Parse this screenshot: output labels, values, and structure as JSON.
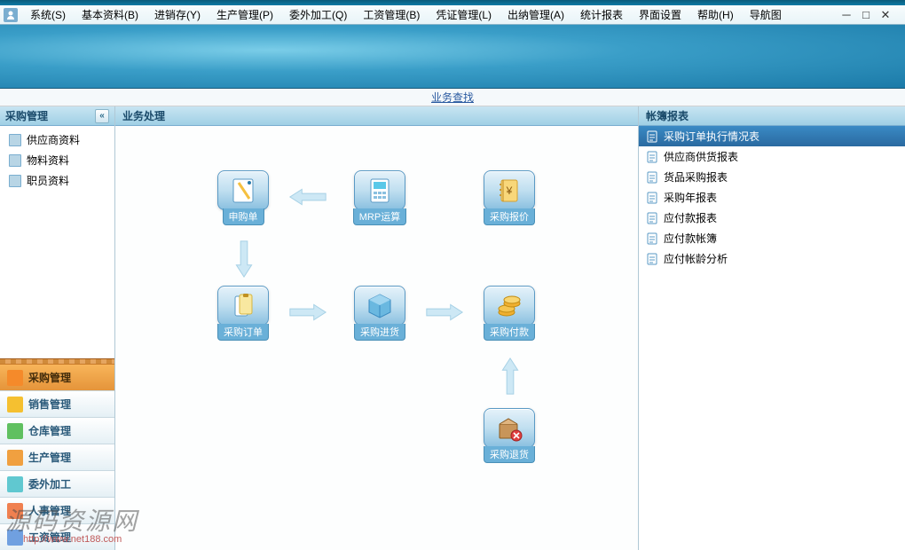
{
  "menu": {
    "items": [
      {
        "label": "系统",
        "k": "S"
      },
      {
        "label": "基本资料",
        "k": "B"
      },
      {
        "label": "进销存",
        "k": "Y"
      },
      {
        "label": "生产管理",
        "k": "P"
      },
      {
        "label": "委外加工",
        "k": "Q"
      },
      {
        "label": "工资管理",
        "k": "B"
      },
      {
        "label": "凭证管理",
        "k": "L"
      },
      {
        "label": "出纳管理",
        "k": "A"
      },
      {
        "label": "统计报表",
        "k": ""
      },
      {
        "label": "界面设置",
        "k": ""
      },
      {
        "label": "帮助",
        "k": "H"
      },
      {
        "label": "导航图",
        "k": ""
      }
    ]
  },
  "toplink": "业务查找",
  "sidebar": {
    "title": "采购管理",
    "items": [
      "供应商资料",
      "物料资料",
      "职员资料"
    ],
    "stack": [
      {
        "label": "采购管理",
        "active": true
      },
      {
        "label": "销售管理",
        "active": false
      },
      {
        "label": "仓库管理",
        "active": false
      },
      {
        "label": "生产管理",
        "active": false
      },
      {
        "label": "委外加工",
        "active": false
      },
      {
        "label": "人事管理",
        "active": false
      },
      {
        "label": "工资管理",
        "active": false
      }
    ]
  },
  "biz": {
    "title": "业务处理",
    "nodes": {
      "req": "申购单",
      "mrp": "MRP运算",
      "quote": "采购报价",
      "order": "采购订单",
      "in": "采购进货",
      "pay": "采购付款",
      "ret": "采购退货"
    }
  },
  "reports": {
    "title": "帐簿报表",
    "items": [
      "采购订单执行情况表",
      "供应商供货报表",
      "货品采购报表",
      "采购年报表",
      "应付款报表",
      "应付款帐簿",
      "应付帐龄分析"
    ],
    "selected_index": 0
  },
  "watermark": {
    "title": "源码资源网",
    "url": "http://www.net188.com"
  }
}
